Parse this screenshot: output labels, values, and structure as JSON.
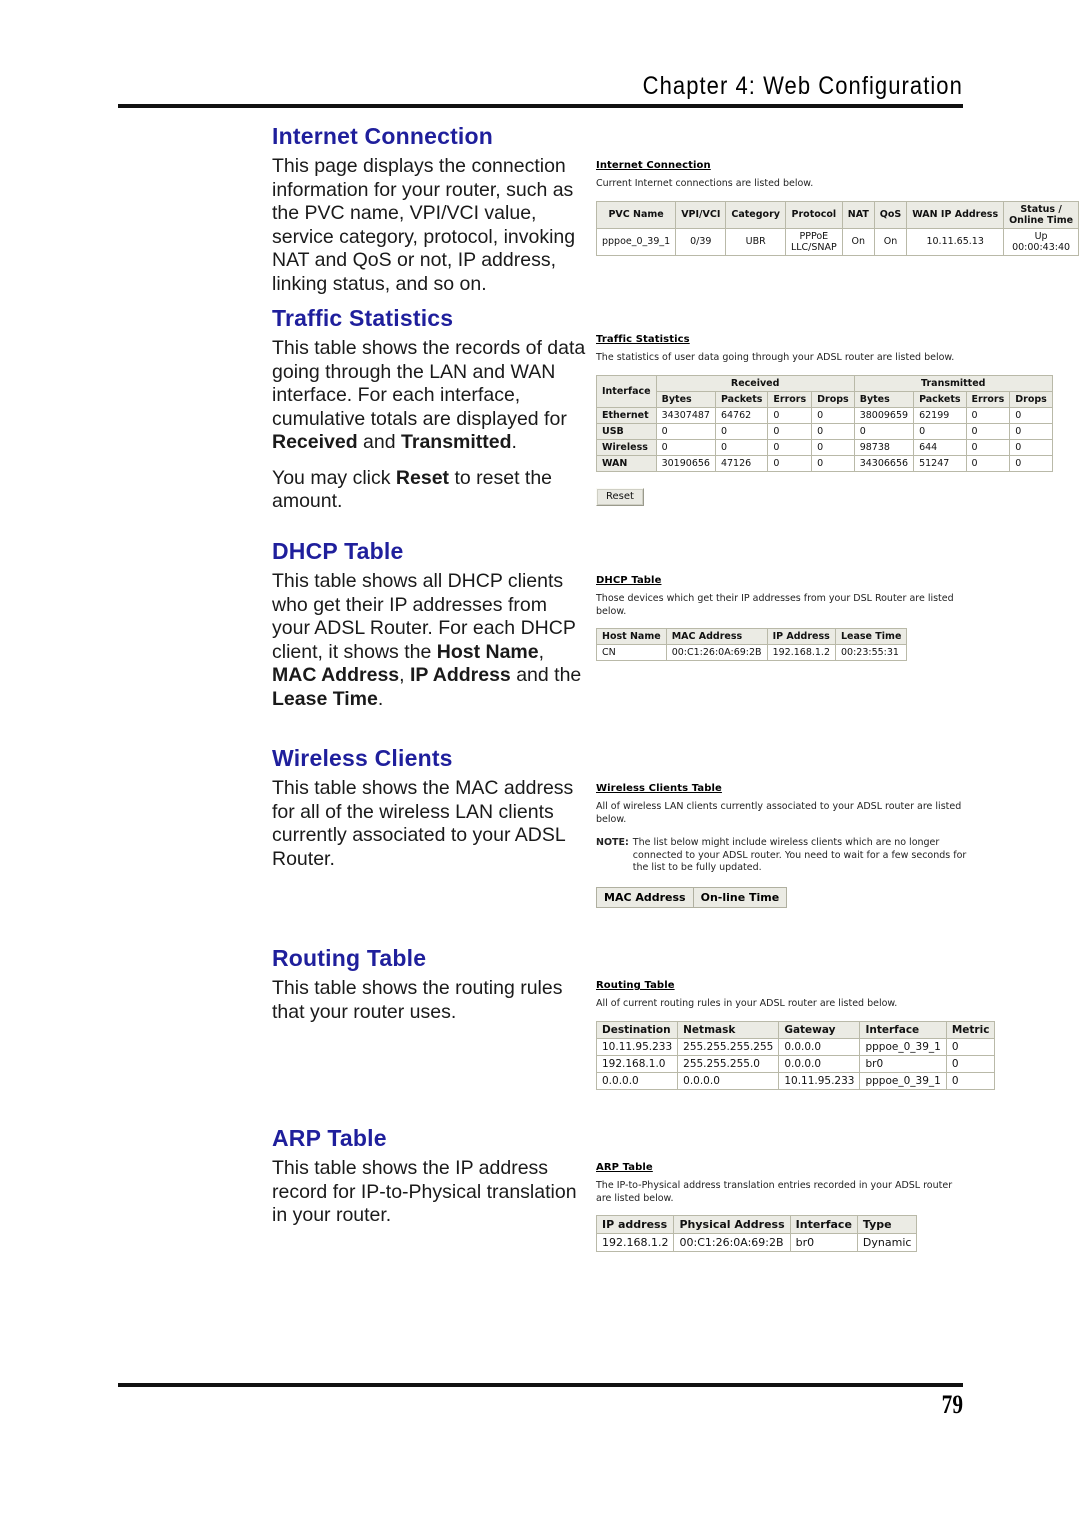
{
  "header": {
    "chapter_title": "Chapter 4: Web Configuration"
  },
  "footer": {
    "page_number": "79"
  },
  "theme": {
    "heading_color": "#1f1f9c",
    "table_header_bg": "#ebebe4",
    "table_border": "#b9b9a8"
  },
  "sections": {
    "internet_connection": {
      "title": "Internet Connection",
      "paragraph": "This page displays the connection information for your router, such as the PVC name, VPI/VCI value, service category, protocol, invoking NAT and QoS or not, IP address, linking status, and so on."
    },
    "traffic_statistics": {
      "title": "Traffic Statistics",
      "paragraph_1_a": "This table shows the records of data going through the LAN and WAN interface. For each interface, cumulative totals are displayed for ",
      "paragraph_1_b": "Received",
      "paragraph_1_c": " and ",
      "paragraph_1_d": "Transmitted",
      "paragraph_1_e": ".",
      "paragraph_2_a": "You may click ",
      "paragraph_2_b": "Reset",
      "paragraph_2_c": " to reset the amount."
    },
    "dhcp_table": {
      "title": "DHCP Table",
      "paragraph_a": "This table shows all DHCP clients who get their IP addresses from your ADSL Router. For each DHCP client, it shows the ",
      "paragraph_b": "Host Name",
      "paragraph_c": ", ",
      "paragraph_d": "MAC Address",
      "paragraph_e": ", ",
      "paragraph_f": "IP Address",
      "paragraph_g": " and the ",
      "paragraph_h": "Lease Time",
      "paragraph_i": "."
    },
    "wireless_clients": {
      "title": "Wireless Clients",
      "paragraph": "This table shows the MAC address for all of the wireless LAN clients currently associated to your ADSL Router."
    },
    "routing_table": {
      "title": "Routing Table",
      "paragraph": "This table shows the routing rules that your router uses."
    },
    "arp_table": {
      "title": "ARP Table",
      "paragraph": "This table shows the IP address record for IP-to-Physical translation in your router."
    }
  },
  "screenshots": {
    "internet_connection": {
      "title": "Internet Connection",
      "description": "Current Internet connections are listed below.",
      "columns": [
        "PVC Name",
        "VPI/VCI",
        "Category",
        "Protocol",
        "NAT",
        "QoS",
        "WAN IP Address",
        "Status / Online Time"
      ],
      "status_header_line1": "Status /",
      "status_header_line2": "Online Time",
      "rows": [
        {
          "pvc_name": "pppoe_0_39_1",
          "vpi_vci": "0/39",
          "category": "UBR",
          "protocol_line1": "PPPoE",
          "protocol_line2": "LLC/SNAP",
          "nat": "On",
          "qos": "On",
          "wan_ip": "10.11.65.13",
          "status_line1": "Up",
          "status_line2": "00:00:43:40"
        }
      ]
    },
    "traffic_statistics": {
      "title": "Traffic Statistics",
      "description": "The statistics of user data going through your ADSL router are listed below.",
      "group_interface": "Interface",
      "group_received": "Received",
      "group_transmitted": "Transmitted",
      "sub_columns": [
        "Bytes",
        "Packets",
        "Errors",
        "Drops",
        "Bytes",
        "Packets",
        "Errors",
        "Drops"
      ],
      "rows": [
        {
          "interface": "Ethernet",
          "rx_bytes": "34307487",
          "rx_packets": "64762",
          "rx_errors": "0",
          "rx_drops": "0",
          "tx_bytes": "38009659",
          "tx_packets": "62199",
          "tx_errors": "0",
          "tx_drops": "0"
        },
        {
          "interface": "USB",
          "rx_bytes": "0",
          "rx_packets": "0",
          "rx_errors": "0",
          "rx_drops": "0",
          "tx_bytes": "0",
          "tx_packets": "0",
          "tx_errors": "0",
          "tx_drops": "0"
        },
        {
          "interface": "Wireless",
          "rx_bytes": "0",
          "rx_packets": "0",
          "rx_errors": "0",
          "rx_drops": "0",
          "tx_bytes": "98738",
          "tx_packets": "644",
          "tx_errors": "0",
          "tx_drops": "0"
        },
        {
          "interface": "WAN",
          "rx_bytes": "30190656",
          "rx_packets": "47126",
          "rx_errors": "0",
          "rx_drops": "0",
          "tx_bytes": "34306656",
          "tx_packets": "51247",
          "tx_errors": "0",
          "tx_drops": "0"
        }
      ],
      "reset_button": "Reset"
    },
    "dhcp_table": {
      "title": "DHCP Table",
      "description": "Those devices which get their IP addresses from your DSL Router are listed below.",
      "columns": [
        "Host Name",
        "MAC Address",
        "IP Address",
        "Lease Time"
      ],
      "rows": [
        {
          "host_name": "CN",
          "mac_address": "00:C1:26:0A:69:2B",
          "ip_address": "192.168.1.2",
          "lease_time": "00:23:55:31"
        }
      ]
    },
    "wireless_clients": {
      "title": "Wireless Clients Table",
      "description": "All of wireless LAN clients currently associated to your ADSL router are listed below.",
      "note_label": "NOTE:",
      "note_text": "The list below might include wireless clients which are no longer connected to your ADSL router. You need to wait for a few seconds for the list to be fully updated.",
      "columns": [
        "MAC Address",
        "On-line Time"
      ],
      "rows": []
    },
    "routing_table": {
      "title": "Routing Table",
      "description": "All of current routing rules in your ADSL router are listed below.",
      "columns": [
        "Destination",
        "Netmask",
        "Gateway",
        "Interface",
        "Metric"
      ],
      "rows": [
        {
          "destination": "10.11.95.233",
          "netmask": "255.255.255.255",
          "gateway": "0.0.0.0",
          "interface": "pppoe_0_39_1",
          "metric": "0"
        },
        {
          "destination": "192.168.1.0",
          "netmask": "255.255.255.0",
          "gateway": "0.0.0.0",
          "interface": "br0",
          "metric": "0"
        },
        {
          "destination": "0.0.0.0",
          "netmask": "0.0.0.0",
          "gateway": "10.11.95.233",
          "interface": "pppoe_0_39_1",
          "metric": "0"
        }
      ]
    },
    "arp_table": {
      "title": "ARP Table",
      "description": "The IP-to-Physical address translation entries recorded in your ADSL router are listed below.",
      "columns": [
        "IP address",
        "Physical Address",
        "Interface",
        "Type"
      ],
      "rows": [
        {
          "ip_address": "192.168.1.2",
          "physical_address": "00:C1:26:0A:69:2B",
          "interface": "br0",
          "type": "Dynamic"
        }
      ]
    }
  }
}
